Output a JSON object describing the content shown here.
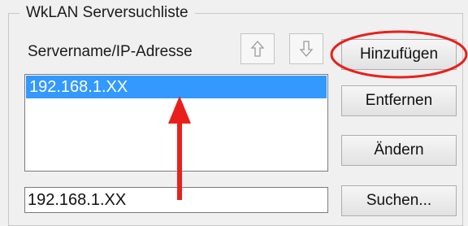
{
  "group": {
    "title": "WkLAN Serversuchliste"
  },
  "server_label": "Servername/IP-Adresse",
  "icons": {
    "move_up": "arrow-up-icon",
    "move_down": "arrow-down-icon"
  },
  "list": {
    "items": [
      "192.168.1.XX"
    ],
    "selected_index": 0
  },
  "input": {
    "value": "192.168.1.XX"
  },
  "buttons": {
    "add": "Hinzufügen",
    "remove": "Entfernen",
    "change": "Ändern",
    "search": "Suchen..."
  },
  "colors": {
    "selection": "#3399ff",
    "annotation": "#e8201d"
  }
}
